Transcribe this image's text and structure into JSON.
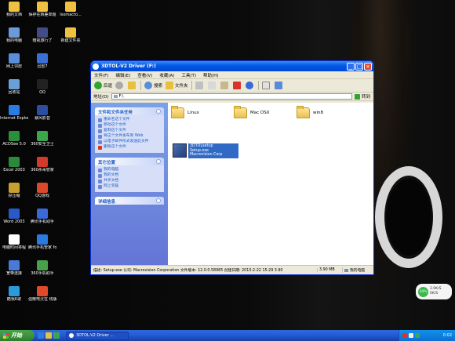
{
  "desktop_icons": [
    {
      "label": "我的文档",
      "color": "#f0c040"
    },
    {
      "label": "保存在转差单题",
      "color": "#f0c040"
    },
    {
      "label": "Isomacto...",
      "color": "#f0c040"
    },
    {
      "label": "我的电脑",
      "color": "#6c9ad8"
    },
    {
      "label": "暗视旅行了",
      "color": "#444c88"
    },
    {
      "label": "新建文件夹",
      "color": "#f0c040"
    },
    {
      "label": "网上邻居",
      "color": "#5a8ed8"
    },
    {
      "label": "迅雷7",
      "color": "#3a6fd8"
    },
    {
      "label": "回收站",
      "color": "#6aa0d8"
    },
    {
      "label": "QQ",
      "color": "#222222"
    },
    {
      "label": "Internet Explorer",
      "color": "#2c7be0"
    },
    {
      "label": "暴风影音",
      "color": "#2c4ea0"
    },
    {
      "label": "ACDSee 5.0",
      "color": "#2a8f3a"
    },
    {
      "label": "360安全卫士",
      "color": "#3aa84a"
    },
    {
      "label": "Excel 2003",
      "color": "#2a8a3a"
    },
    {
      "label": "360杀毒管家",
      "color": "#d23a2a"
    },
    {
      "label": "好压缩",
      "color": "#c8a030"
    },
    {
      "label": "QQ游戏",
      "color": "#d84a2a"
    },
    {
      "label": "Word 2003",
      "color": "#2a5ac8"
    },
    {
      "label": "腾讯手机助手",
      "color": "#3a6ad8"
    },
    {
      "label": "电脑时间将程",
      "color": "#ffffff"
    },
    {
      "label": "腾讯手机管家 for",
      "color": "#2a7ae0"
    },
    {
      "label": "宽带连接",
      "color": "#4a7ad8"
    },
    {
      "label": "360手机助手",
      "color": "#4aa04a"
    },
    {
      "label": "酷我K歌",
      "color": "#2a9ad8"
    },
    {
      "label": "强散电灵在 线版",
      "color": "#e04a2a"
    }
  ],
  "window": {
    "title": "3DTOL-V2 Driver (F:)",
    "menu": [
      "文件(F)",
      "编辑(E)",
      "查看(V)",
      "收藏(A)",
      "工具(T)",
      "帮助(H)"
    ],
    "toolbar": {
      "back": "后退",
      "search": "搜索",
      "folders": "文件夹"
    },
    "address_label": "地址(D)",
    "address_value": "F:\\",
    "go_label": "转到",
    "tasks": {
      "file_folder_tasks": {
        "title": "文件和文件夹任务",
        "items": [
          "重命名这个文件",
          "移动这个文件",
          "复制这个文件",
          "将这个文件发布到 Web",
          "以电子邮件形式发送此文件",
          "删除这个文件"
        ]
      },
      "other_places": {
        "title": "其它位置",
        "items": [
          "我的电脑",
          "我的文档",
          "共享文档",
          "网上邻居"
        ]
      },
      "details": {
        "title": "详细信息"
      }
    },
    "folders": [
      "Linux",
      "Mac OSX",
      "win8"
    ],
    "selected_file": {
      "name": "3DTOLsetup",
      "desc": "Setup.exe",
      "company": "Macrovision Corp"
    },
    "status": {
      "main": "描述: Setup.exe 公司: Macrovision Corporation 文件版本: 12.0.0.58985 创建日期: 2013-2-22 15:29 3.90",
      "size": "3.90 MB",
      "location": "我的电脑"
    }
  },
  "net_widget": {
    "percent": "34%",
    "up": "2.0K/S",
    "down": "0K/S"
  },
  "taskbar": {
    "start": "开始",
    "task": "3DTOL-V2 Driver ...",
    "clock": "0:02"
  }
}
